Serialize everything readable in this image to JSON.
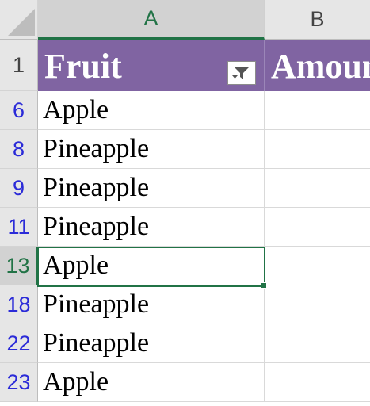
{
  "columns": [
    {
      "label": "A"
    },
    {
      "label": "B"
    }
  ],
  "header_row": {
    "row_number": "1",
    "cells": [
      "Fruit",
      "Amount"
    ]
  },
  "rows": [
    {
      "num": "6",
      "fruit": "Apple"
    },
    {
      "num": "8",
      "fruit": "Pineapple"
    },
    {
      "num": "9",
      "fruit": "Pineapple"
    },
    {
      "num": "11",
      "fruit": "Pineapple"
    },
    {
      "num": "13",
      "fruit": "Apple"
    },
    {
      "num": "18",
      "fruit": "Pineapple"
    },
    {
      "num": "22",
      "fruit": "Pineapple"
    },
    {
      "num": "23",
      "fruit": "Apple"
    }
  ],
  "active_cell": "A13",
  "filter_icon": "filter-dropdown-icon",
  "colors": {
    "header_fill": "#8064a2",
    "selection": "#217346",
    "filtered_row_numbers": "#2b2bd8"
  }
}
